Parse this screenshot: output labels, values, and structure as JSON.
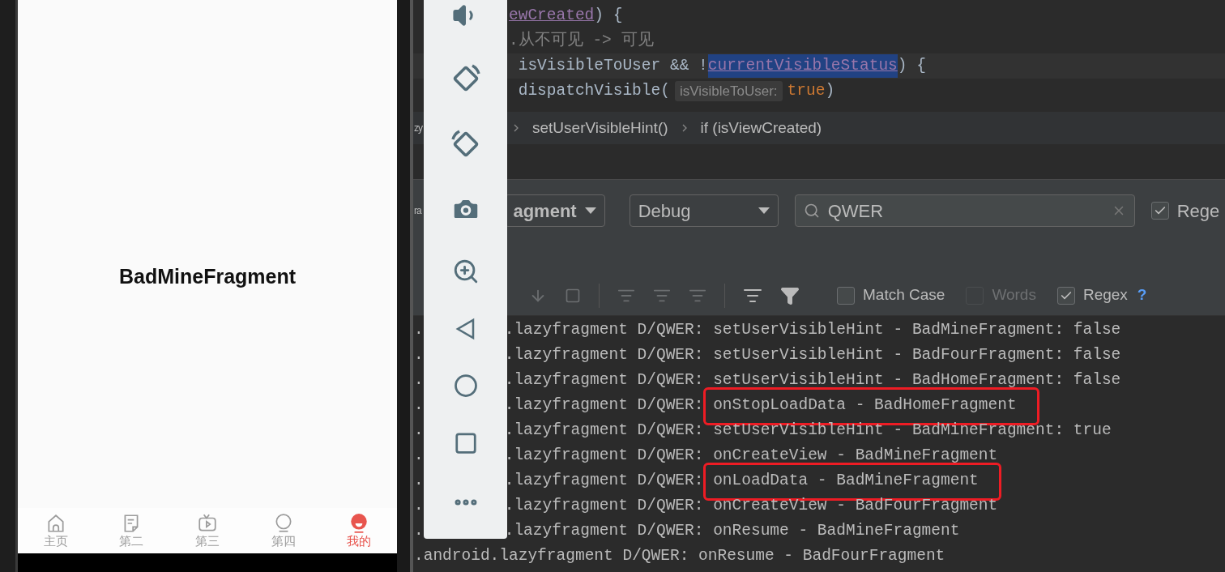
{
  "phone": {
    "title": "BadMineFragment",
    "nav": [
      {
        "kind": "home",
        "label": "主页",
        "selected": false
      },
      {
        "kind": "note",
        "label": "第二",
        "selected": false
      },
      {
        "kind": "tv",
        "label": "第三",
        "selected": false
      },
      {
        "kind": "bubble",
        "label": "第四",
        "selected": false
      },
      {
        "kind": "face",
        "label": "我的",
        "selected": true
      }
    ]
  },
  "editor": {
    "lines": [
      [
        {
          "kind": "field",
          "text": "ewCreated"
        },
        {
          "kind": "plain",
          "text": ") {"
        }
      ],
      [
        {
          "kind": "comment",
          "text": ".从不可见 -> 可见"
        }
      ],
      [
        {
          "kind": "plain",
          "text": " isVisibleToUser && !"
        },
        {
          "kind": "found",
          "text": "currentVisibleStatus"
        },
        {
          "kind": "plain",
          "text": ") {"
        }
      ],
      [
        {
          "kind": "plain",
          "text": " dispatchVisible("
        },
        {
          "kind": "hint",
          "text": "isVisibleToUser:"
        },
        {
          "kind": "keyword",
          "text": "true"
        },
        {
          "kind": "plain",
          "text": ")"
        }
      ]
    ],
    "breadcrumb": {
      "edge": "zy",
      "items": [
        "setUserVisibleHint()",
        "if (isViewCreated)"
      ]
    }
  },
  "logcat": {
    "edge": "ra",
    "process_filter": "agment",
    "level_filter": "Debug",
    "search": {
      "value": "QWER"
    },
    "regex_top": {
      "label": "Rege",
      "checked": true
    },
    "options": [
      {
        "label": "Match Case",
        "checked": false,
        "disabled": false
      },
      {
        "label": "Words",
        "checked": false,
        "disabled": true
      },
      {
        "label": "Regex",
        "checked": true,
        "disabled": false
      }
    ],
    "help": "?",
    "rows": [
      {
        "edge": ".",
        "tag": ".lazyfragment D/QWER:",
        "message": "setUserVisibleHint - BadMineFragment: false",
        "highlighted": false
      },
      {
        "edge": ".",
        "tag": ".lazyfragment D/QWER:",
        "message": "setUserVisibleHint - BadFourFragment: false",
        "highlighted": false
      },
      {
        "edge": ".",
        "tag": ".lazyfragment D/QWER:",
        "message": "setUserVisibleHint - BadHomeFragment: false",
        "highlighted": false
      },
      {
        "edge": ".",
        "tag": ".lazyfragment D/QWER:",
        "message": "onStopLoadData - BadHomeFragment",
        "highlighted": true
      },
      {
        "edge": ".",
        "tag": ".lazyfragment D/QWER:",
        "message": "setUserVisibleHint - BadMineFragment: true",
        "highlighted": false
      },
      {
        "edge": ".",
        "tag": ".lazyfragment D/QWER:",
        "message": "onCreateView - BadMineFragment",
        "highlighted": false
      },
      {
        "edge": ".",
        "tag": ".lazyfragment D/QWER:",
        "message": "onLoadData - BadMineFragment",
        "highlighted": true
      },
      {
        "edge": ".",
        "tag": ".lazyfragment D/QWER:",
        "message": "onCreateView - BadFourFragment",
        "highlighted": false
      },
      {
        "edge": ".",
        "tag": ".lazyfragment D/QWER:",
        "message": "onResume - BadMineFragment",
        "highlighted": false
      },
      {
        "tag": ".android.lazyfragment D/QWER:",
        "message": "onResume - BadFourFragment",
        "highlighted": false
      }
    ]
  }
}
